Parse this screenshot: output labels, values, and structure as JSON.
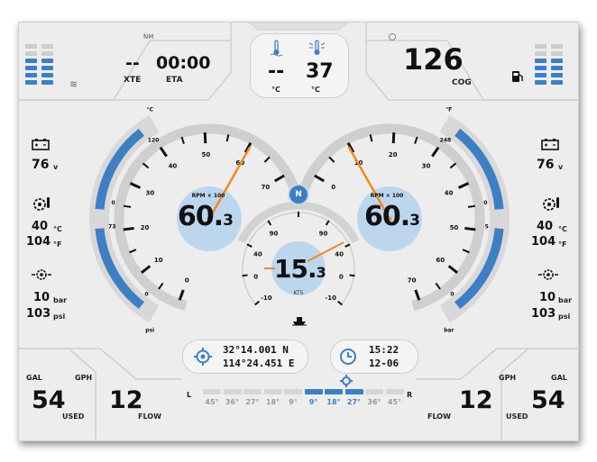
{
  "top_left": {
    "nm_label": "NM",
    "xte_value": "--",
    "xte_label": "XTE",
    "eta_value": "00:00",
    "eta_label": "ETA",
    "levels": [
      4,
      4
    ],
    "wave_icon": "waves-icon"
  },
  "top_center": {
    "temp1_value": "--",
    "temp1_unit": "°C",
    "temp2_value": "37",
    "temp2_unit": "°C",
    "temp1_icon": "water-temp-icon",
    "temp2_icon": "sea-temp-icon"
  },
  "top_right": {
    "cog_value": "126",
    "cog_label": "COG",
    "levels": [
      4,
      4
    ],
    "fuel_icon": "fuel-pump-icon"
  },
  "left_side": {
    "voltage_value": "76",
    "voltage_unit": "v",
    "temp_c_value": "40",
    "temp_c_unit": "°C",
    "temp_f_value": "104",
    "temp_f_unit": "°F",
    "pressure_bar_value": "10",
    "pressure_bar_unit": "bar",
    "pressure_psi_value": "103",
    "pressure_psi_unit": "psi",
    "battery_icon": "battery-icon",
    "temp_icon": "engine-temp-icon",
    "oil_icon": "oil-pressure-icon"
  },
  "right_side": {
    "voltage_value": "76",
    "voltage_unit": "v",
    "temp_c_value": "40",
    "temp_c_unit": "°C",
    "temp_f_value": "104",
    "temp_f_unit": "°F",
    "pressure_bar_value": "10",
    "pressure_bar_unit": "bar",
    "pressure_psi_value": "103",
    "pressure_psi_unit": "psi",
    "battery_icon": "battery-icon",
    "temp_icon": "engine-temp-icon",
    "oil_icon": "oil-pressure-icon"
  },
  "left_tach": {
    "rpm_label": "RPM × 100",
    "value_main": "60.",
    "value_sub": "3",
    "ticks": [
      "0",
      "10",
      "20",
      "30",
      "40",
      "50",
      "60",
      "70"
    ],
    "reading": 60.3,
    "temp_scale": {
      "unit": "°C",
      "top": "120",
      "mid": "0"
    },
    "pressure_scale": {
      "unit": "psi",
      "top": "73",
      "mid": "0"
    },
    "temp_fill": 1.0,
    "pressure_fill": 1.0
  },
  "right_tach": {
    "rpm_label": "RPM × 100",
    "value_main": "60.",
    "value_sub": "3",
    "ticks": [
      "0",
      "10",
      "20",
      "30",
      "40",
      "50",
      "60",
      "70"
    ],
    "reading": 60.3,
    "temp_scale": {
      "unit": "°F",
      "top": "248",
      "mid": "0"
    },
    "pressure_scale": {
      "unit": "bar",
      "top": "5",
      "mid": "0"
    },
    "temp_fill": 1.0,
    "pressure_fill": 1.0
  },
  "speed": {
    "value_main": "15.",
    "value_sub": "3",
    "unit": "KTS",
    "ticks_left": [
      "-10",
      "0",
      "40",
      "90"
    ],
    "ticks_right": [
      "-10",
      "0",
      "40",
      "90"
    ],
    "compass_label": "N"
  },
  "position": {
    "lat": "32°14.001 N",
    "lon": "114°24.451 E",
    "icon": "gps-target-icon"
  },
  "clock": {
    "time": "15:22",
    "date": "12-06",
    "icon": "clock-icon"
  },
  "bottom_left": {
    "gal_label": "GAL",
    "used_value": "54",
    "used_label": "USED",
    "gph_label": "GPH",
    "flow_value": "12",
    "flow_label": "FLOW"
  },
  "bottom_right": {
    "gal_label": "GAL",
    "used_value": "54",
    "used_label": "USED",
    "gph_label": "GPH",
    "flow_value": "12",
    "flow_label": "FLOW"
  },
  "rudder": {
    "left_label": "L",
    "right_label": "R",
    "icon": "rudder-icon",
    "labels": [
      "45°",
      "36°",
      "27°",
      "18°",
      "9°",
      "9°",
      "18°",
      "27°",
      "36°",
      "45°"
    ],
    "active": [
      false,
      false,
      false,
      false,
      false,
      true,
      true,
      true,
      false,
      false
    ],
    "colors": {
      "active": "#3e7fc4",
      "inactive": "#d6d6d6",
      "active_text": "#3e7fc4",
      "inactive_text": "#9a9a9a"
    }
  }
}
